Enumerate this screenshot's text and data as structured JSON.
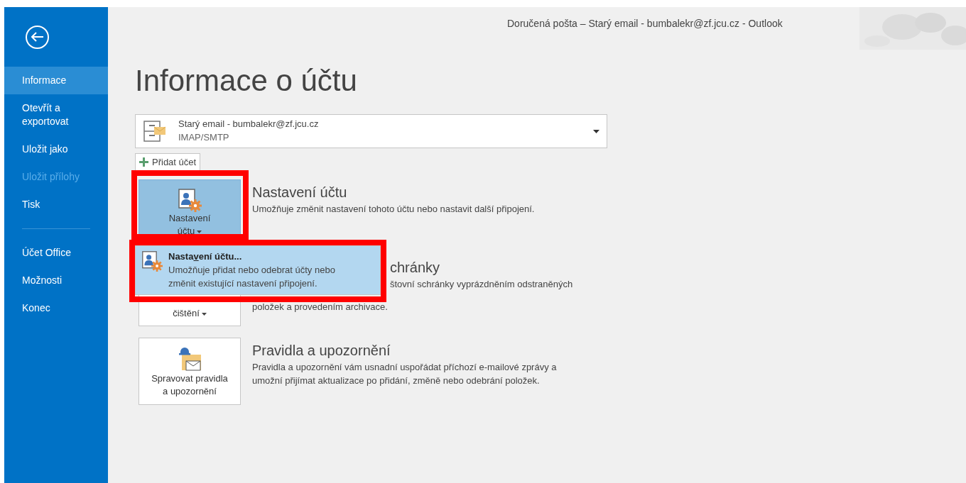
{
  "window": {
    "title": "Doručená pošta – Starý email - bumbalekr@zf.jcu.cz - Outlook"
  },
  "sidebar": {
    "groups": [
      [
        {
          "label": "Informace",
          "selected": true,
          "disabled": false
        },
        {
          "label": "Otevřít a exportovat",
          "selected": false,
          "disabled": false
        },
        {
          "label": "Uložit jako",
          "selected": false,
          "disabled": false
        },
        {
          "label": "Uložit přílohy",
          "selected": false,
          "disabled": true
        },
        {
          "label": "Tisk",
          "selected": false,
          "disabled": false
        }
      ],
      [
        {
          "label": "Účet Office",
          "selected": false,
          "disabled": false
        },
        {
          "label": "Možnosti",
          "selected": false,
          "disabled": false
        },
        {
          "label": "Konec",
          "selected": false,
          "disabled": false
        }
      ]
    ]
  },
  "heading": "Informace o účtu",
  "account": {
    "name": "Starý email - bumbalekr@zf.jcu.cz",
    "type": "IMAP/SMTP"
  },
  "add_account_button": "Přidat účet",
  "sections": [
    {
      "kind": "account",
      "button_lines": [
        "Nastavení",
        "účtu"
      ],
      "has_menu": true,
      "selected": true,
      "title": "Nastavení účtu",
      "description": [
        "Umožňuje změnit nastavení tohoto účtu nebo nastavit další připojení."
      ]
    },
    {
      "kind": "hidden",
      "button_lines": [
        "čištění"
      ],
      "has_menu": true,
      "selected": false,
      "title": "chránky",
      "description": [
        "štovní schránky vyprázdněním odstraněných",
        "položek a provedením archivace."
      ]
    },
    {
      "kind": "rules",
      "button_lines": [
        "Spravovat pravidla",
        "a upozornění"
      ],
      "has_menu": false,
      "selected": false,
      "title": "Pravidla a upozornění",
      "description": [
        "Pravidla a upozornění vám usnadní uspořádat příchozí e-mailové zprávy a",
        "umožní přijímat aktualizace po přidání, změně nebo odebrání položek."
      ]
    }
  ],
  "dropdown_menu": {
    "items": [
      {
        "label_before": "Nasta",
        "access_key": "v",
        "label_after": "ení účtu...",
        "description": [
          "Umožňuje přidat nebo odebrat účty nebo",
          "změnit existující nastavení připojení."
        ],
        "selected": true
      }
    ]
  }
}
